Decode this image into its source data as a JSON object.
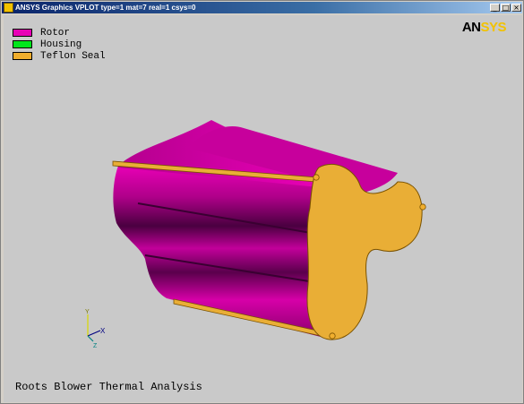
{
  "window": {
    "title": "ANSYS Graphics   VPLOT  type=1 mat=7 real=1 csys=0",
    "buttons": {
      "minimize": "_",
      "maximize": "□",
      "close": "×"
    }
  },
  "legend": [
    {
      "label": "Rotor",
      "color": "#e800b6"
    },
    {
      "label": "Housing",
      "color": "#00e61b"
    },
    {
      "label": "Teflon Seal",
      "color": "#f0ae2e"
    }
  ],
  "logo": {
    "part1": "AN",
    "part2": "SYS"
  },
  "triad": {
    "x": "X",
    "y": "Y",
    "z": "Z"
  },
  "footer_title": "Roots Blower Thermal Analysis",
  "colors": {
    "viewport_bg": "#c9c9c9",
    "rotor_dark": "#3a0030",
    "rotor_mid": "#a0007e",
    "rotor_light": "#e800b6",
    "seal": "#e9ae36",
    "seal_edge": "#7a5200"
  }
}
